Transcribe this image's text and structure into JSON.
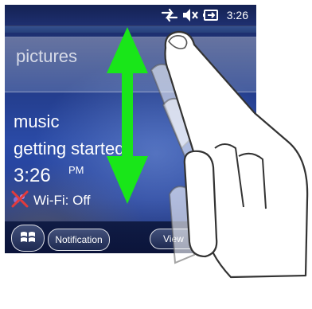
{
  "status_bar": {
    "time": "3:26",
    "icons": [
      "connection-sync-icon",
      "volume-muted-icon",
      "battery-charging-icon"
    ]
  },
  "home": {
    "pictures_label": "pictures",
    "items": [
      "music",
      "getting started"
    ],
    "clock_time": "3:26",
    "clock_ampm": "PM",
    "wifi_status": "Wi-Fi: Off"
  },
  "bottom_bar": {
    "start_icon": "windows-logo-icon",
    "notification_label": "Notification",
    "view_label": "View"
  },
  "gesture": {
    "arrow_icon": "vertical-double-arrow-icon",
    "hand_icon": "swiping-hand-icon",
    "arrow_color": "#19e619"
  }
}
